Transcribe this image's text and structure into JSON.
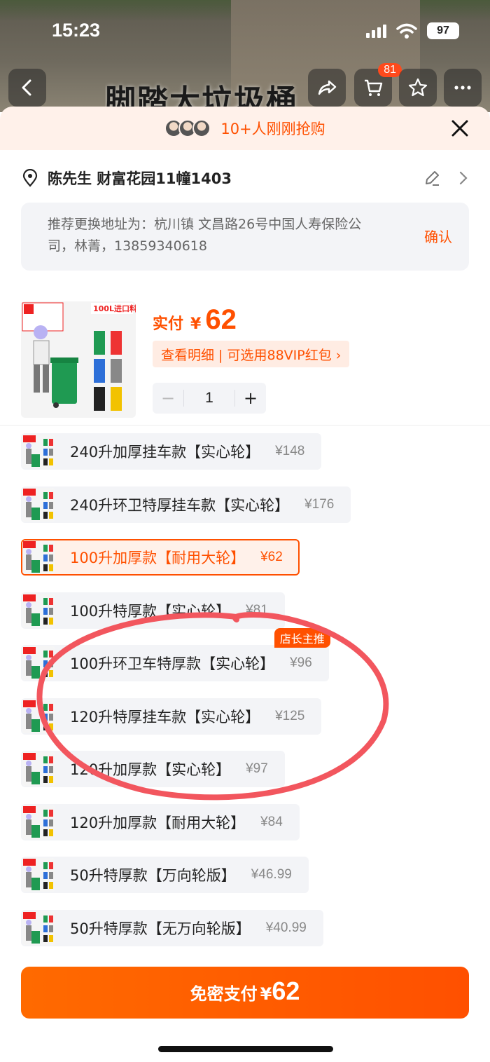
{
  "status_bar": {
    "time": "15:23",
    "battery": "97"
  },
  "background": {
    "title_text": "脚踏大垃圾桶"
  },
  "nav": {
    "cart_badge": "81"
  },
  "promo": {
    "text": "10+人刚刚抢购"
  },
  "address": {
    "recipient_line": "陈先生 财富花园11幢1403",
    "suggestion": "推荐更换地址为：杭川镇 文昌路26号中国人寿保险公司，林菁，13859340618",
    "confirm_label": "确认"
  },
  "product": {
    "price_label": "实付",
    "currency": "¥",
    "price": "62",
    "detail_link": "查看明细 | 可选用88VIP红包 ›",
    "qty_minus": "−",
    "qty_value": "1",
    "qty_plus": "+",
    "image_badge": "100L进口料"
  },
  "skus": [
    {
      "name": "240升加厚挂车款【实心轮】",
      "price": "¥148",
      "selected": false,
      "badge": ""
    },
    {
      "name": "240升环卫特厚挂车款【实心轮】",
      "price": "¥176",
      "selected": false,
      "badge": ""
    },
    {
      "name": "100升加厚款【耐用大轮】",
      "price": "¥62",
      "selected": true,
      "badge": ""
    },
    {
      "name": "100升特厚款【实心轮】",
      "price": "¥81",
      "selected": false,
      "badge": ""
    },
    {
      "name": "100升环卫车特厚款【实心轮】",
      "price": "¥96",
      "selected": false,
      "badge": "店长主推"
    },
    {
      "name": "120升特厚挂车款【实心轮】",
      "price": "¥125",
      "selected": false,
      "badge": ""
    },
    {
      "name": "120升加厚款【实心轮】",
      "price": "¥97",
      "selected": false,
      "badge": ""
    },
    {
      "name": "120升加厚款【耐用大轮】",
      "price": "¥84",
      "selected": false,
      "badge": ""
    },
    {
      "name": "50升特厚款【万向轮版】",
      "price": "¥46.99",
      "selected": false,
      "badge": ""
    },
    {
      "name": "50升特厚款【无万向轮版】",
      "price": "¥40.99",
      "selected": false,
      "badge": ""
    }
  ],
  "pay": {
    "label": "免密支付",
    "currency": "¥",
    "amount": "62"
  },
  "colors": {
    "accent": "#ff5000",
    "accent_bg": "#fff1ea",
    "field_bg": "#f3f4f7",
    "annotation_red": "#f2565e"
  },
  "icons": [
    "back-icon",
    "share-icon",
    "cart-icon",
    "star-icon",
    "more-icon",
    "close-icon",
    "location-pin-icon",
    "edit-icon",
    "chevron-right-icon"
  ]
}
